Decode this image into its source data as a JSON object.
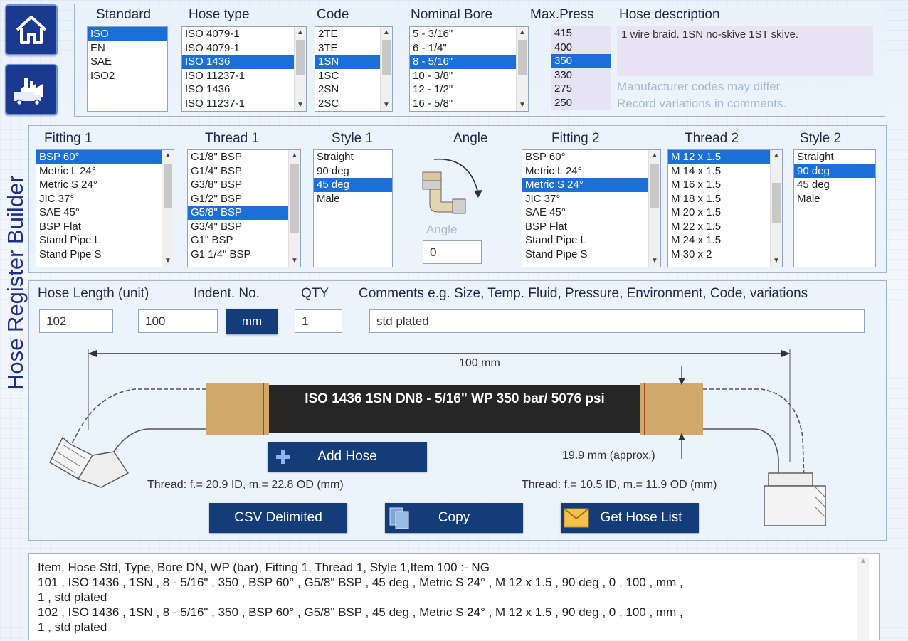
{
  "app_title": "Hose Register Builder",
  "nav": {
    "home_icon": "home-icon",
    "factory_icon": "factory-truck-icon"
  },
  "top": {
    "standard": {
      "label": "Standard",
      "items": [
        "ISO",
        "EN",
        "SAE",
        "ISO2"
      ],
      "selected": 0
    },
    "hose_type": {
      "label": "Hose type",
      "items": [
        "ISO 4079-1",
        "ISO 4079-1",
        "ISO 1436",
        "ISO 11237-1",
        "ISO 1436",
        "ISO 11237-1"
      ],
      "selected": 2
    },
    "code": {
      "label": "Code",
      "items": [
        "2TE",
        "3TE",
        "1SN",
        "1SC",
        "2SN",
        "2SC"
      ],
      "selected": 2
    },
    "nominal_bore": {
      "label": "Nominal Bore",
      "items": [
        "5 - 3/16\"",
        "6 - 1/4\"",
        "8 - 5/16\"",
        "10 - 3/8\"",
        "12 - 1/2\"",
        "16 - 5/8\""
      ],
      "selected": 2
    },
    "max_press": {
      "label": "Max.Press",
      "items": [
        "415",
        "400",
        "350",
        "330",
        "275",
        "250"
      ],
      "selected": 2
    },
    "hose_description": {
      "label": "Hose description",
      "value": "1 wire braid. 1SN no-skive 1ST skive."
    },
    "note_line1": "Manufacturer codes may differ.",
    "note_line2": "Record variations in comments."
  },
  "fittings": {
    "fitting1": {
      "label": "Fitting 1",
      "items": [
        "BSP 60°",
        "Metric L 24°",
        "Metric S 24°",
        "JIC 37°",
        "SAE 45°",
        "BSP Flat",
        "Stand Pipe L",
        "Stand Pipe S"
      ],
      "selected": 0
    },
    "thread1": {
      "label": "Thread 1",
      "items": [
        "G1/8\" BSP",
        "G1/4\" BSP",
        "G3/8\" BSP",
        "G1/2\" BSP",
        "G5/8\" BSP",
        "G3/4\" BSP",
        "G1\" BSP",
        "G1 1/4\" BSP"
      ],
      "selected": 4
    },
    "style1": {
      "label": "Style 1",
      "items": [
        "Straight",
        "90 deg",
        "45 deg",
        "Male"
      ],
      "selected": 2
    },
    "angle": {
      "label": "Angle",
      "input_label": "Angle",
      "value": "0"
    },
    "fitting2": {
      "label": "Fitting 2",
      "items": [
        "BSP 60°",
        "Metric L 24°",
        "Metric S 24°",
        "JIC 37°",
        "SAE 45°",
        "BSP Flat",
        "Stand Pipe L",
        "Stand Pipe S"
      ],
      "selected": 2
    },
    "thread2": {
      "label": "Thread 2",
      "items": [
        "M 12 x 1.5",
        "M 14 x 1.5",
        "M 16 x 1.5",
        "M 18 x 1.5",
        "M 20 x 1.5",
        "M 22 x 1.5",
        "M 24 x 1.5",
        "M 30 x 2"
      ],
      "selected": 0
    },
    "style2": {
      "label": "Style 2",
      "items": [
        "Straight",
        "90 deg",
        "45 deg",
        "Male"
      ],
      "selected": 1
    }
  },
  "form": {
    "hose_length_label": "Hose Length (unit)",
    "indent_label": "Indent. No.",
    "qty_label": "QTY",
    "comments_label": "Comments e.g. Size, Temp. Fluid, Pressure, Environment, Code, variations",
    "item_value": "102",
    "length_value": "100",
    "unit_button": "mm",
    "qty_value": "1",
    "comments_value": "std plated"
  },
  "diagram": {
    "length_dim": "100 mm",
    "hose_text": "ISO 1436 1SN DN8 - 5/16\" WP 350 bar/ 5076 psi",
    "od_dim": "19.9 mm (approx.)",
    "thread_left": "Thread: f.= 20.9 ID, m.= 22.8 OD (mm)",
    "thread_right": "Thread: f.= 10.5 ID, m.= 11.9 OD (mm)"
  },
  "buttons": {
    "add_hose": "Add Hose",
    "csv": "CSV Delimited",
    "copy": "Copy",
    "get_list": "Get Hose List"
  },
  "output": {
    "lines": [
      "Item, Hose Std, Type, Bore DN, WP (bar), Fitting 1, Thread 1, Style 1,Item 100 :-  NG",
      "101 , ISO 1436 , 1SN , 8 - 5/16\" , 350 , BSP 60° ,  G5/8\" BSP , 45 deg , Metric S 24° , M 12 x 1.5 , 90 deg , 0 , 100 , mm ,",
      "1 , std plated",
      "102 , ISO 1436 , 1SN , 8 - 5/16\" , 350 , BSP 60° ,  G5/8\" BSP , 45 deg , Metric S 24° , M 12 x 1.5 , 90 deg , 0 , 100 , mm ,",
      "1 , std plated"
    ]
  },
  "colors": {
    "accent": "#143c78",
    "selection": "#1c6fd6",
    "brass": "#cfa86a",
    "hose": "#262626"
  }
}
